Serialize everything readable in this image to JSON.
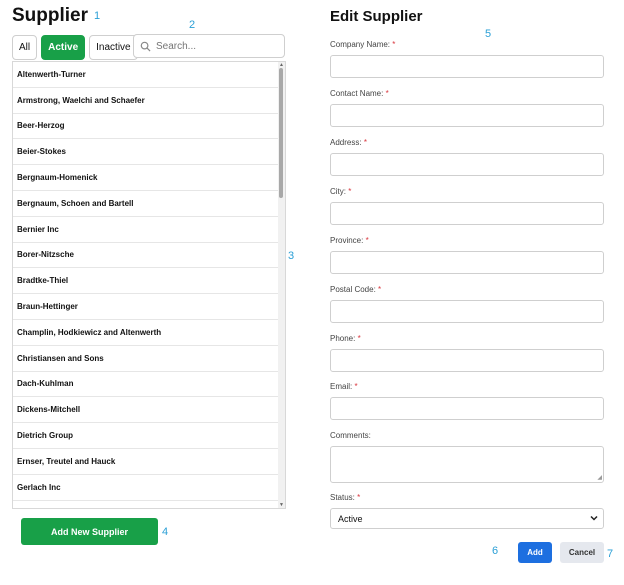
{
  "left_panel": {
    "title": "Supplier",
    "filters": {
      "all": "All",
      "active": "Active",
      "inactive": "Inactive"
    },
    "search_placeholder": "Search...",
    "suppliers": [
      "Altenwerth-Turner",
      "Armstrong, Waelchi and Schaefer",
      "Beer-Herzog",
      "Beier-Stokes",
      "Bergnaum-Homenick",
      "Bergnaum, Schoen and Bartell",
      "Bernier Inc",
      "Borer-Nitzsche",
      "Bradtke-Thiel",
      "Braun-Hettinger",
      "Champlin, Hodkiewicz and Altenwerth",
      "Christiansen and Sons",
      "Dach-Kuhlman",
      "Dickens-Mitchell",
      "Dietrich Group",
      "Ernser, Treutel and Hauck",
      "Gerlach Inc"
    ],
    "add_button": "Add New Supplier"
  },
  "right_panel": {
    "title": "Edit Supplier",
    "fields": {
      "company_name": "Company Name:",
      "contact_name": "Contact Name:",
      "address": "Address:",
      "city": "City:",
      "province": "Province:",
      "postal_code": "Postal Code:",
      "phone": "Phone:",
      "email": "Email:",
      "comments": "Comments:",
      "status": "Status:"
    },
    "required_mark": "*",
    "status_value": "Active",
    "add_button": "Add",
    "cancel_button": "Cancel"
  },
  "annotations": [
    "1",
    "2",
    "3",
    "4",
    "5",
    "6",
    "7"
  ],
  "colors": {
    "green": "#18a048",
    "blue": "#1d6fe0",
    "marker": "#2a9fd6",
    "required": "#d9363e"
  }
}
